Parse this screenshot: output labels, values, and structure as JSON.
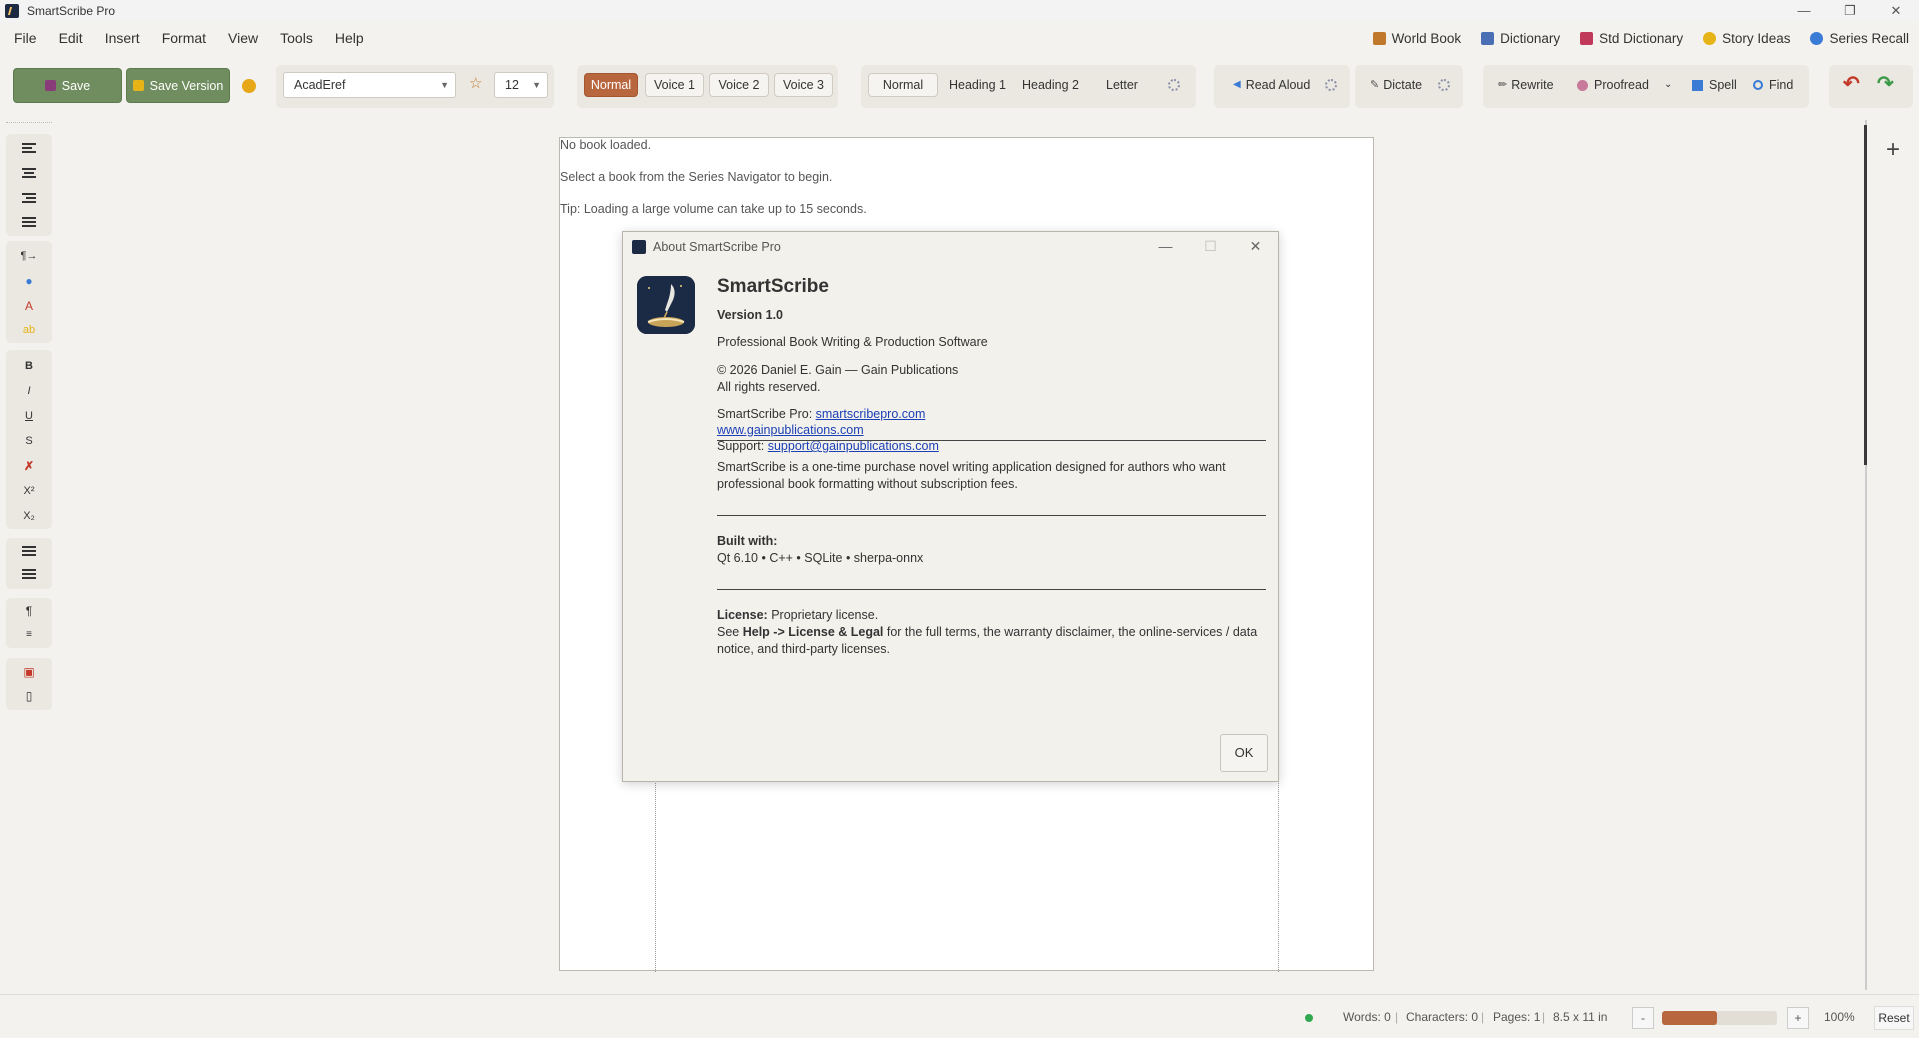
{
  "window": {
    "title": "SmartScribe Pro",
    "controls": [
      "—",
      "❐",
      "✕"
    ]
  },
  "menu": [
    "File",
    "Edit",
    "Insert",
    "Format",
    "View",
    "Tools",
    "Help"
  ],
  "tool_links": [
    {
      "label": "World Book",
      "icon": "book-icon",
      "color": "#c0792c"
    },
    {
      "label": "Dictionary",
      "icon": "dictionary-icon",
      "color": "#4a6fb5"
    },
    {
      "label": "Std Dictionary",
      "icon": "std-dictionary-icon",
      "color": "#c0395a"
    },
    {
      "label": "Story Ideas",
      "icon": "lightbulb-icon",
      "color": "#e6b417"
    },
    {
      "label": "Series Recall",
      "icon": "search-icon",
      "color": "#3a7bd5"
    }
  ],
  "toolbar": {
    "save_label": "Save",
    "save_version_label": "Save Version",
    "font": "AcadEref",
    "font_size": "12",
    "voices": [
      "Normal",
      "Voice 1",
      "Voice 2",
      "Voice 3"
    ],
    "active_voice": "Normal",
    "styles": [
      "Normal",
      "Heading 1",
      "Heading 2",
      "Letter"
    ],
    "read_aloud": "Read Aloud",
    "dictate": "Dictate",
    "rewrite": "Rewrite",
    "proofread": "Proofread",
    "spell": "Spell",
    "find": "Find",
    "undo_symbol": "↶",
    "redo_symbol": "↷"
  },
  "left_rail": {
    "format_glyphs": {
      "bold": "B",
      "italic": "I",
      "underline": "U",
      "strike": "S",
      "superscript": "X²",
      "subscript": "X₂",
      "text_color": "A",
      "highlight": "ab",
      "pilcrow": "¶"
    }
  },
  "editor": {
    "message_line1": "No book loaded.",
    "message_line2": "Select a book from the Series Navigator to begin.",
    "message_line3": "Tip: Loading a large volume can take up to 15 seconds."
  },
  "dialog": {
    "title": "About SmartScribe Pro",
    "app_name": "SmartScribe",
    "version": "Version 1.0",
    "tagline": "Professional Book Writing & Production Software",
    "copyright": "© 2026 Daniel E. Gain — Gain Publications",
    "rights": "All rights reserved.",
    "pro_label": "SmartScribe Pro: ",
    "pro_link": "smartscribepro.com",
    "site_link": "www.gainpublications.com",
    "support_label": "Support: ",
    "support_link": "support@gainpublications.com",
    "description": "SmartScribe is a one-time purchase novel writing application designed for authors who want professional book formatting without subscription fees.",
    "built_with_label": "Built with:",
    "built_with": "Qt 6.10 • C++ • SQLite • sherpa-onnx",
    "license_label": "License:",
    "license_value": " Proprietary license.",
    "license_see": "See ",
    "license_path": "Help -> License & Legal",
    "license_rest": " for the full terms, the warranty disclaimer, the online-services / data notice, and third-party licenses.",
    "ok_label": "OK"
  },
  "status": {
    "words": "Words: 0",
    "characters": "Characters: 0",
    "pages": "Pages: 1",
    "page_size": "8.5 x 11 in",
    "zoom_minus": "-",
    "zoom_plus": "+",
    "zoom": "100%",
    "zoom_fraction": 0.48,
    "reset": "Reset",
    "separator": "|"
  }
}
